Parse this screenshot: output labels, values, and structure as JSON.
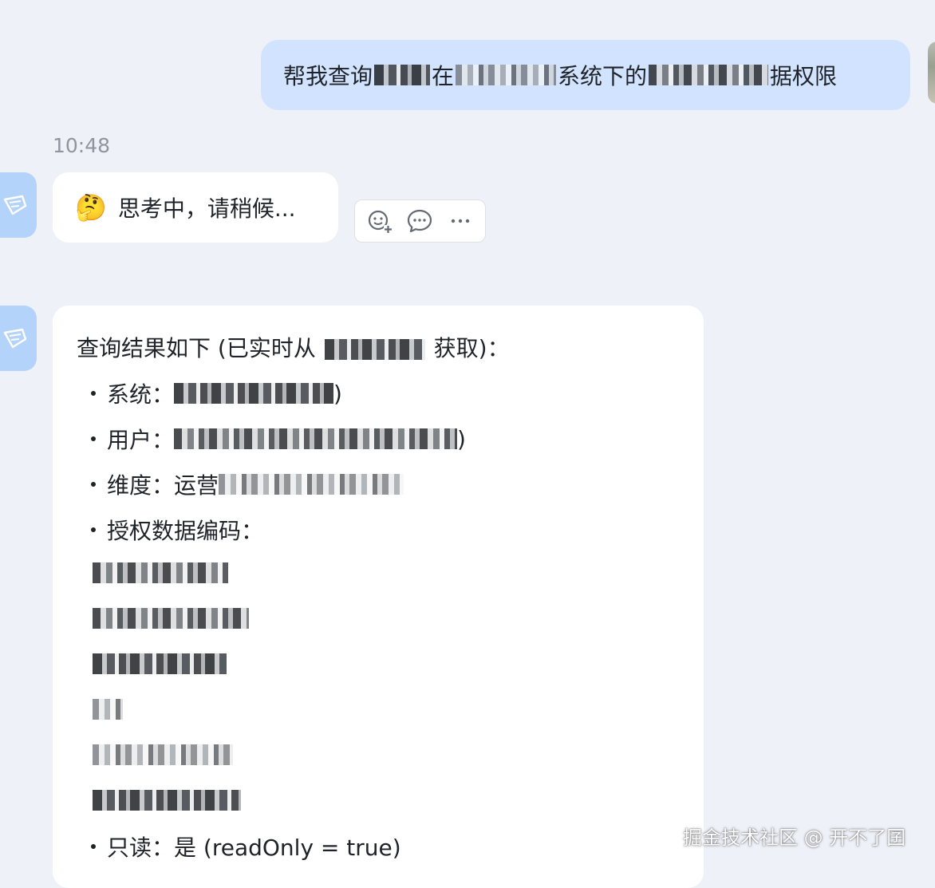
{
  "outgoing": {
    "segments": [
      "帮我查询",
      "在",
      "系统下的",
      "据权限"
    ]
  },
  "timestamp": "10:48",
  "thinking": {
    "emoji": "🤔",
    "text": "思考中，请稍候..."
  },
  "actions": {
    "icons": [
      "add-reaction-icon",
      "reply-comment-icon",
      "more-icon"
    ],
    "more_label": "···"
  },
  "result": {
    "title_prefix": "查询结果如下 (已实时从",
    "title_suffix": "获取)：",
    "system_label": "系统：",
    "system_tail": ")",
    "user_label": "用户：",
    "user_tail": ")",
    "dimension_label": "维度：",
    "dimension_value": "运营",
    "codes_label": "授权数据编码：",
    "readonly_label": "只读：",
    "readonly_value": "是 (readOnly = true)"
  },
  "watermark": "掘金技术社区 @ 开不了囝"
}
